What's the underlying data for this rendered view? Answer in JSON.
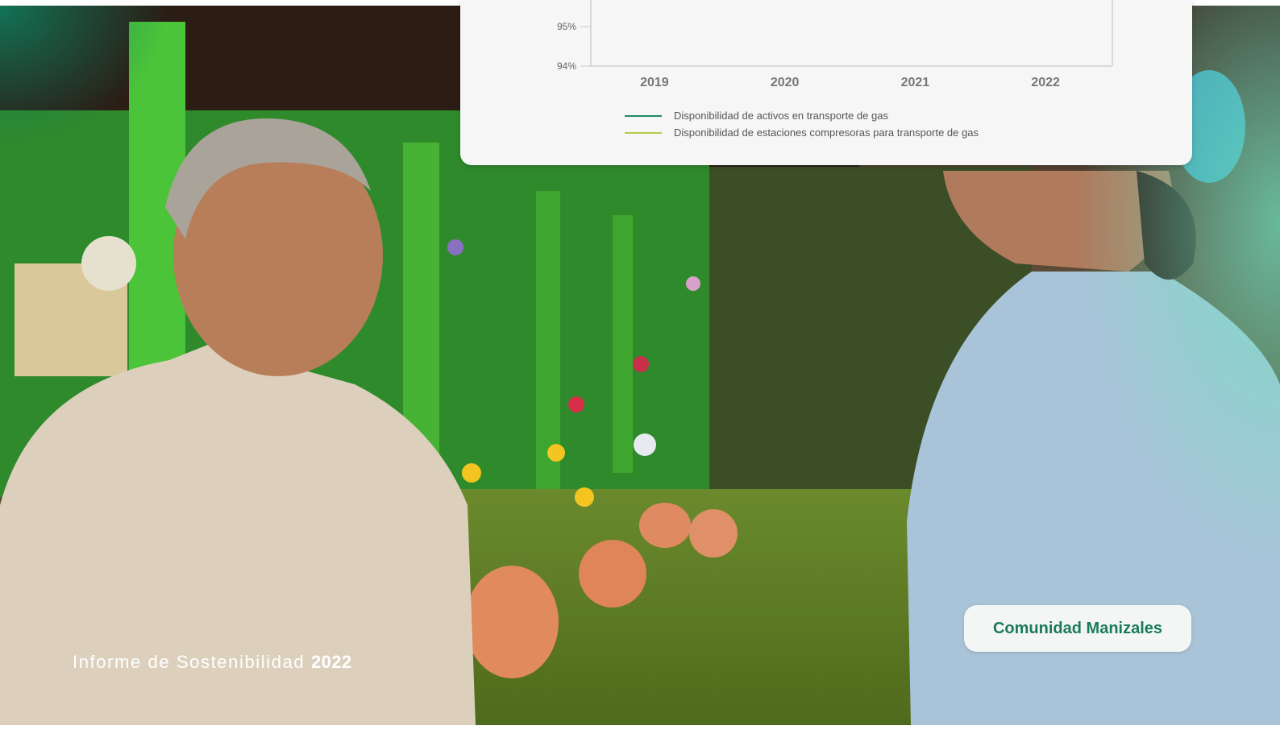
{
  "chart_data": {
    "type": "line",
    "categories": [
      "2019",
      "2020",
      "2021",
      "2022"
    ],
    "y_ticks": [
      "95%",
      "94%"
    ],
    "ylim_visible": [
      94,
      95
    ],
    "grid": false,
    "legend_placement": "bottom-left",
    "series": [
      {
        "name": "Disponibilidad de activos en transporte de gas",
        "color": "#1d8a6b"
      },
      {
        "name": "Disponibilidad de estaciones compresoras para transporte de gas",
        "color": "#b7cd48"
      }
    ]
  },
  "footer": {
    "title_regular": "Informe de Sostenibilidad",
    "title_year": "2022"
  },
  "badge": {
    "label": "Comunidad Manizales"
  },
  "colors": {
    "accent_green": "#1c7a5c",
    "teal_overlay": "#3fbfa0"
  }
}
